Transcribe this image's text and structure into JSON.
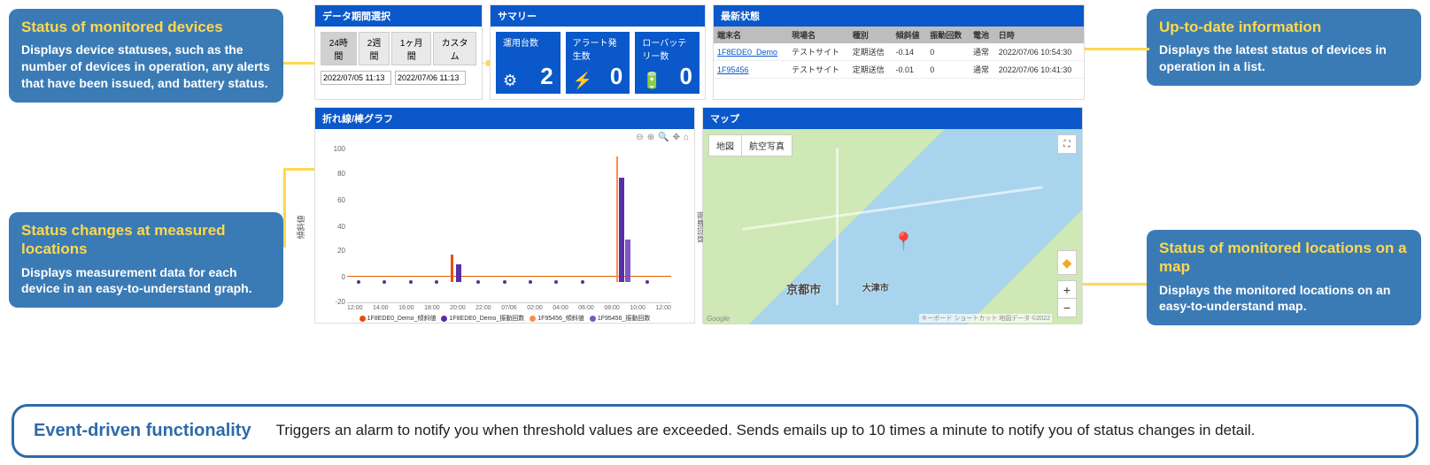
{
  "callouts": {
    "tl": {
      "title": "Status of monitored devices",
      "body": "Displays device statuses, such as the number of devices in operation, any alerts that have been issued, and battery status."
    },
    "bl": {
      "title": "Status changes at measured locations",
      "body": "Displays measurement data for each device in an easy-to-understand graph."
    },
    "tr": {
      "title": "Up-to-date information",
      "body": "Displays the latest status of devices in operation in a list."
    },
    "br": {
      "title": "Status of monitored locations on a map",
      "body": "Displays the monitored locations on an easy-to-understand map."
    }
  },
  "period": {
    "title": "データ期間選択",
    "opts": [
      "24時間",
      "2週間",
      "1ヶ月間",
      "カスタム"
    ],
    "from": "2022/07/05 11:13",
    "to": "2022/07/06 11:13"
  },
  "summary": {
    "title": "サマリー",
    "stats": [
      {
        "label": "運用台数",
        "val": "2",
        "icon": "⚙"
      },
      {
        "label": "アラート発生数",
        "val": "0",
        "icon": "⚡"
      },
      {
        "label": "ローバッテリー数",
        "val": "0",
        "icon": "🔋"
      }
    ]
  },
  "latest": {
    "title": "最新状態",
    "cols": [
      "端末名",
      "現場名",
      "種別",
      "傾斜値",
      "振動回数",
      "電池",
      "日時"
    ],
    "rows": [
      {
        "term": "1F8EDE0_Demo",
        "site": "テストサイト",
        "type": "定期送信",
        "tilt": "-0.14",
        "vib": "0",
        "bat": "通常",
        "ts": "2022/07/06 10:54:30"
      },
      {
        "term": "1F95456",
        "site": "テストサイト",
        "type": "定期送信",
        "tilt": "-0.01",
        "vib": "0",
        "bat": "通常",
        "ts": "2022/07/06 10:41:30"
      }
    ]
  },
  "chart_panel": {
    "title": "折れ線/棒グラフ",
    "yl": "傾斜値",
    "yr": "振動回数"
  },
  "chart_data": {
    "type": "line",
    "x": [
      "12:00",
      "14:00",
      "16:00",
      "18:00",
      "20:00",
      "22:00",
      "07/06",
      "02:00",
      "04:00",
      "06:00",
      "08:00",
      "10:00",
      "12:00"
    ],
    "ylim": [
      -20,
      100
    ],
    "ylabel": "傾斜値",
    "ylabel_r": "振動回数",
    "series": [
      {
        "name": "1F8EDE0_Demo_傾斜値",
        "color": "#e65100",
        "values": [
          0,
          0,
          0,
          0,
          22,
          0,
          0,
          0,
          0,
          0,
          0,
          0,
          0
        ]
      },
      {
        "name": "1F8EDE0_Demo_振動回数",
        "color": "#5a2ea6",
        "values": [
          0,
          0,
          0,
          0,
          15,
          0,
          0,
          0,
          0,
          0,
          0,
          0,
          0
        ]
      },
      {
        "name": "1F95456_傾斜値",
        "color": "#ff8a50",
        "values": [
          0,
          0,
          0,
          0,
          0,
          0,
          0,
          0,
          0,
          0,
          0,
          98,
          0
        ]
      },
      {
        "name": "1F95456_振動回数",
        "color": "#7e57c2",
        "values": [
          0,
          0,
          0,
          0,
          0,
          0,
          0,
          0,
          0,
          0,
          0,
          80,
          0
        ]
      }
    ]
  },
  "map": {
    "title": "マップ",
    "map_btn": "地図",
    "sat_btn": "航空写真",
    "city_k": "京都市",
    "city_o": "大津市",
    "google": "Google",
    "rights": "キーボード ショートカット 地図データ ©2022"
  },
  "event": {
    "title": "Event-driven functionality",
    "body": "Triggers an alarm to notify you when threshold values are exceeded. Sends emails up to 10 times a minute to notify you of status changes in detail."
  }
}
